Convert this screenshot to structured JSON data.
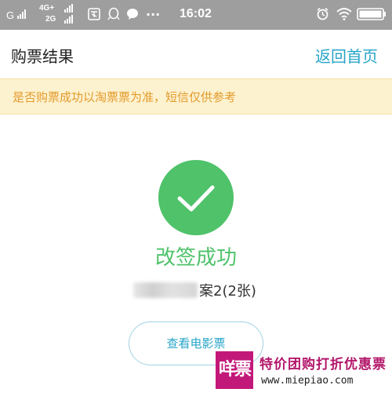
{
  "status_bar": {
    "carrier1": "G",
    "network_4g": "4G+",
    "network_2g": "2G",
    "more": "···",
    "time": "16:02"
  },
  "header": {
    "title": "购票结果",
    "home_link": "返回首页"
  },
  "notice": {
    "text": "是否购票成功以淘票票为准，短信仅供参考"
  },
  "result": {
    "title": "改签成功",
    "ticket_info": "案2(2张)",
    "view_button": "查看电影票"
  },
  "watermark": {
    "logo_text": "咩票",
    "slogan": "特价团购打折优惠票",
    "url": "www.miepiao.com"
  },
  "colors": {
    "status_bar": "#9e9e9e",
    "link": "#27a5c8",
    "notice_bg": "#fdf2cf",
    "notice_text": "#e39a2c",
    "success": "#4fc26a",
    "watermark": "#c2187a"
  }
}
